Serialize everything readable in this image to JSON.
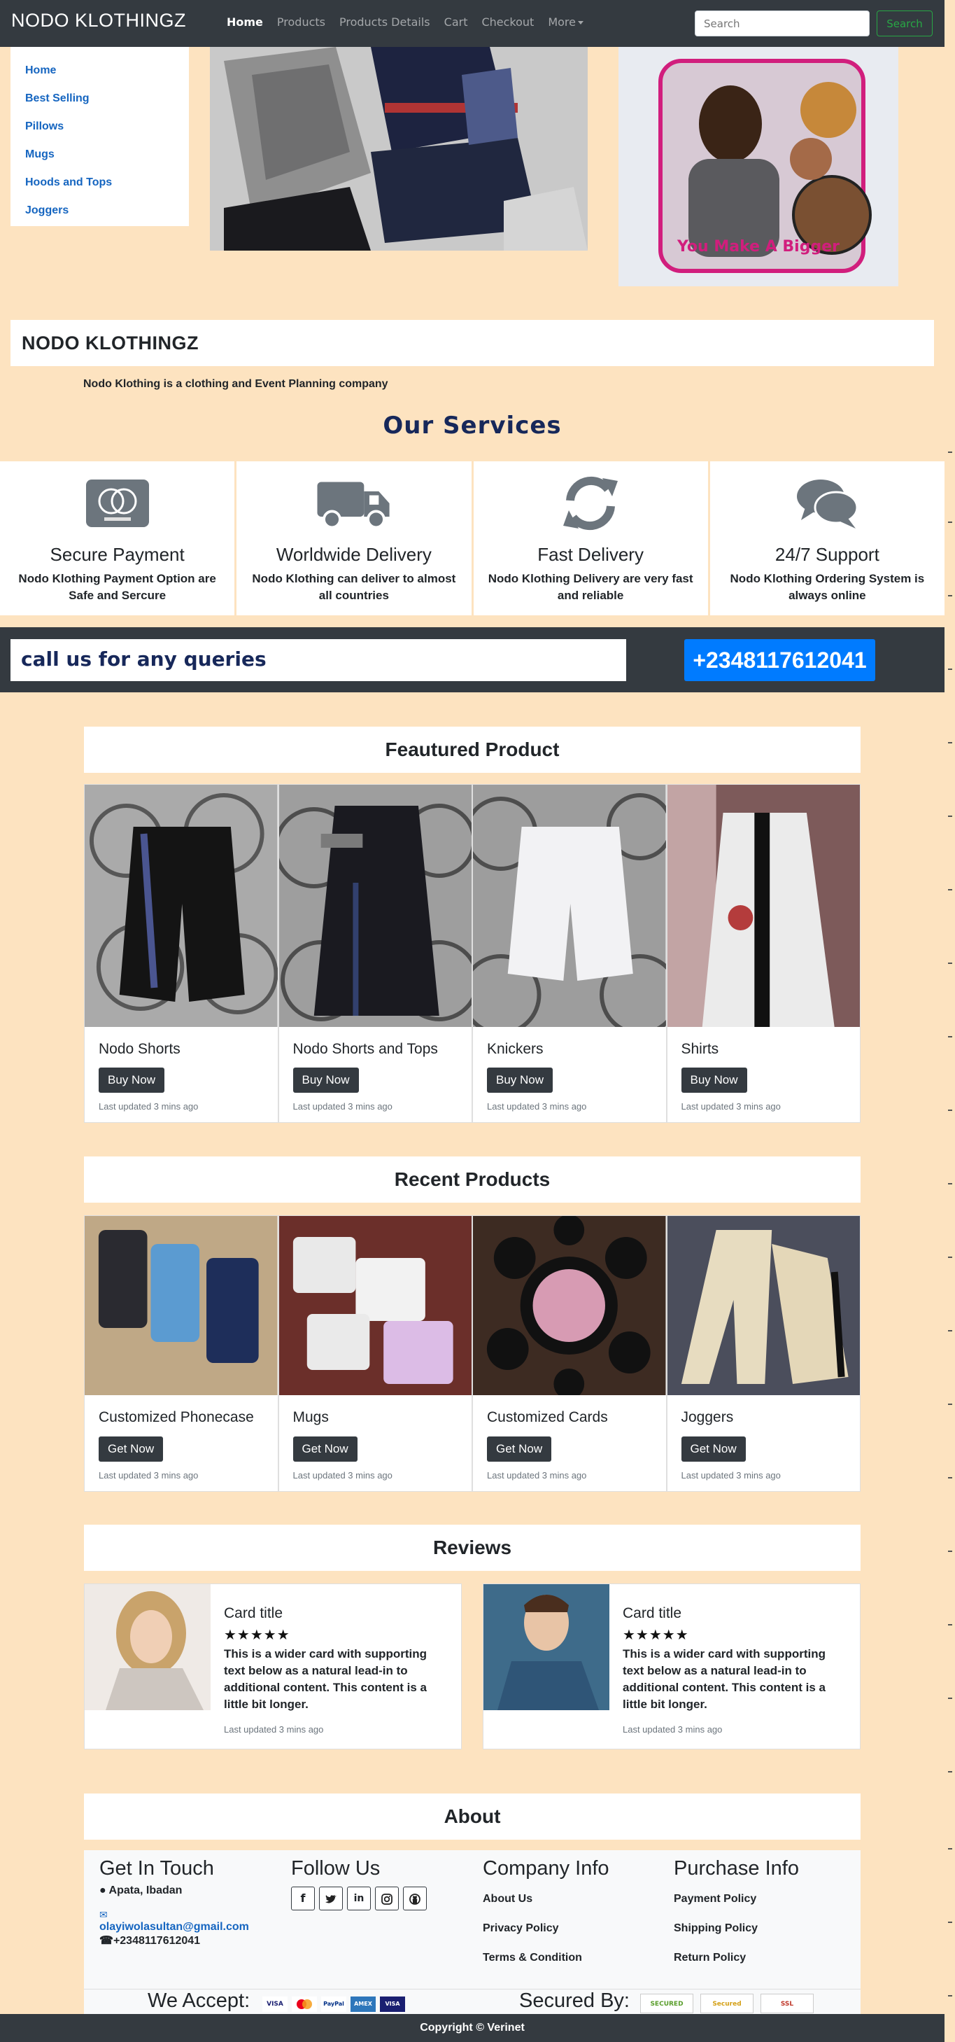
{
  "navbar": {
    "brand": "NODO KLOTHINGZ",
    "links": [
      {
        "label": "Home"
      },
      {
        "label": "Products"
      },
      {
        "label": "Products Details"
      },
      {
        "label": "Cart"
      },
      {
        "label": "Checkout"
      },
      {
        "label": "More"
      }
    ],
    "search_placeholder": "Search",
    "search_button": "Search"
  },
  "sidebar": {
    "items": [
      {
        "label": "Home"
      },
      {
        "label": "Best Selling"
      },
      {
        "label": "Pillows"
      },
      {
        "label": "Mugs"
      },
      {
        "label": "Hoods and Tops"
      },
      {
        "label": "Joggers"
      }
    ]
  },
  "hero": {
    "pillow_caption": "You Make A Bigger"
  },
  "company": {
    "title": "NODO KLOTHINGZ",
    "description": "Nodo Klothing is a clothing and Event Planning company"
  },
  "services": {
    "heading": "Our Services",
    "items": [
      {
        "title": "Secure Payment",
        "desc": "Nodo Klothing Payment Option are Safe and Sercure",
        "icon": "credit-card-icon"
      },
      {
        "title": "Worldwide Delivery",
        "desc": "Nodo Klothing can deliver to almost all countries",
        "icon": "truck-icon"
      },
      {
        "title": "Fast Delivery",
        "desc": "Nodo Klothing Delivery are very fast and reliable",
        "icon": "sync-icon"
      },
      {
        "title": "24/7 Support",
        "desc": "Nodo Klothing Ordering System is always online",
        "icon": "comments-icon"
      }
    ]
  },
  "call": {
    "text": "call us for any queries",
    "number": "+2348117612041"
  },
  "featured": {
    "heading": "Feautured Product",
    "items": [
      {
        "name": "Nodo Shorts",
        "button": "Buy Now",
        "updated": "Last updated 3 mins ago"
      },
      {
        "name": "Nodo Shorts and Tops",
        "button": "Buy Now",
        "updated": "Last updated 3 mins ago"
      },
      {
        "name": "Knickers",
        "button": "Buy Now",
        "updated": "Last updated 3 mins ago"
      },
      {
        "name": "Shirts",
        "button": "Buy Now",
        "updated": "Last updated 3 mins ago"
      }
    ]
  },
  "recent": {
    "heading": "Recent Products",
    "items": [
      {
        "name": "Customized Phonecase",
        "button": "Get Now",
        "updated": "Last updated 3 mins ago"
      },
      {
        "name": "Mugs",
        "button": "Get Now",
        "updated": "Last updated 3 mins ago"
      },
      {
        "name": "Customized Cards",
        "button": "Get Now",
        "updated": "Last updated 3 mins ago"
      },
      {
        "name": "Joggers",
        "button": "Get Now",
        "updated": "Last updated 3 mins ago"
      }
    ]
  },
  "reviews": {
    "heading": "Reviews",
    "items": [
      {
        "title": "Card title",
        "stars": "★★★★★",
        "text": "This is a wider card with supporting text below as a natural lead-in to additional content. This content is a little bit longer.",
        "updated": "Last updated 3 mins ago"
      },
      {
        "title": "Card title",
        "stars": "★★★★★",
        "text": "This is a wider card with supporting text below as a natural lead-in to additional content. This content is a little bit longer.",
        "updated": "Last updated 3 mins ago"
      }
    ]
  },
  "about": {
    "heading": "About"
  },
  "footer": {
    "get_in_touch": {
      "heading": "Get In Touch",
      "address": "Apata, Ibadan",
      "email": "olayiwolasultan@gmail.com",
      "phone": "+2348117612041"
    },
    "follow_us": {
      "heading": "Follow Us",
      "icons": [
        "facebook-icon",
        "twitter-icon",
        "linkedin-icon",
        "instagram-icon",
        "github-icon"
      ]
    },
    "company_info": {
      "heading": "Company Info",
      "links": [
        "About Us",
        "Privacy Policy",
        "Terms & Condition"
      ]
    },
    "purchase_info": {
      "heading": "Purchase Info",
      "links": [
        "Payment Policy",
        "Shipping Policy",
        "Return Policy"
      ]
    },
    "we_accept": "We Accept:",
    "secured_by": "Secured By:",
    "payment_badges": [
      "VISA",
      "",
      "PayPal",
      "AMEX",
      "VISA"
    ],
    "security_badges": [
      "SECURED",
      "Secured",
      "SSL"
    ]
  },
  "copyright": "Copyright © Verinet"
}
